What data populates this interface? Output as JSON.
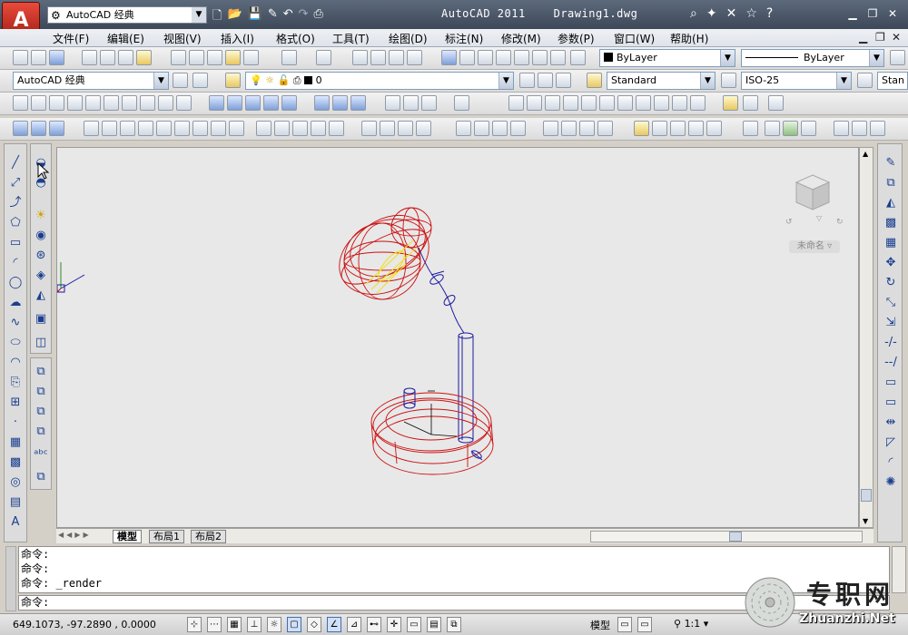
{
  "app": {
    "title": "AutoCAD 2011",
    "file": "Drawing1.dwg",
    "logo": "A",
    "workspace": "AutoCAD 经典"
  },
  "menu": [
    "文件(F)",
    "编辑(E)",
    "视图(V)",
    "插入(I)",
    "格式(O)",
    "工具(T)",
    "绘图(D)",
    "标注(N)",
    "修改(M)",
    "参数(P)",
    "窗口(W)",
    "帮助(H)"
  ],
  "toolbar1": {
    "color": "ByLayer",
    "linetype": "ByLayer"
  },
  "toolbar2": {
    "workspace": "AutoCAD 经典",
    "layer": "0",
    "text_style": "Standard",
    "dim_style": "ISO-25",
    "table_style": "Stan"
  },
  "viewcube": {
    "unnamed": "未命名"
  },
  "tabs": [
    "模型",
    "布局1",
    "布局2"
  ],
  "command": {
    "lines": [
      "命令:",
      "命令:",
      "命令: _render"
    ],
    "prompt": "命令:"
  },
  "status": {
    "coords": "649.1073,   -97.2890 , 0.0000",
    "model": "模型",
    "scale": "1:1"
  },
  "watermark": {
    "text": "专职网",
    "url": "Zhuanzhi.Net"
  },
  "colors": {
    "accent": "#c4281c",
    "cad_red": "#cc1010",
    "cad_blue": "#1a1aa0",
    "cad_yellow": "#f0e020"
  }
}
